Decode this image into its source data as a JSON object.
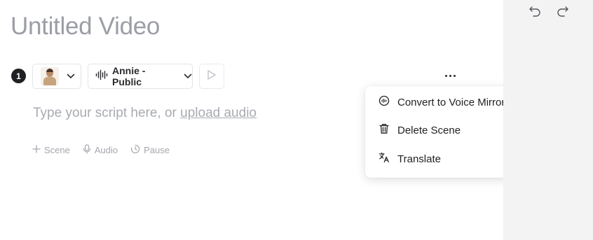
{
  "document": {
    "title": "Untitled Video"
  },
  "scene": {
    "number": "1",
    "voice_label": "Annie - Public",
    "script_placeholder": "Type your script here, or ",
    "upload_link": "upload audio"
  },
  "actions": {
    "scene": "Scene",
    "audio": "Audio",
    "pause": "Pause"
  },
  "context_menu": {
    "items": [
      {
        "label": "Convert to Voice Mirroring",
        "icon": "voice-mirroring-icon"
      },
      {
        "label": "Delete Scene",
        "icon": "trash-icon"
      },
      {
        "label": "Translate",
        "icon": "translate-icon"
      }
    ]
  },
  "toolbar": {
    "undo_icon": "undo-icon",
    "redo_icon": "redo-icon"
  },
  "colors": {
    "sidebar_bg": "#f3f3f4",
    "title_text": "#9b9ea5",
    "muted_text": "#a8abb1",
    "accent_dark": "#1f2023"
  }
}
